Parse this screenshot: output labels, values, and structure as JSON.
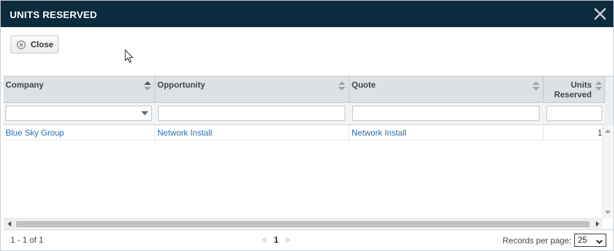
{
  "dialog": {
    "title": "UNITS RESERVED",
    "close_icon": "close-x-icon"
  },
  "toolbar": {
    "close_label": "Close",
    "close_icon": "circle-x-icon"
  },
  "grid": {
    "columns": [
      {
        "label": "Company",
        "sort": "ascending"
      },
      {
        "label": "Opportunity",
        "sort": "none"
      },
      {
        "label": "Quote",
        "sort": "none"
      },
      {
        "label": "Units Reserved",
        "label_line1": "Units",
        "label_line2": "Reserved",
        "sort": "none"
      }
    ],
    "filters": [
      {
        "type": "select",
        "value": ""
      },
      {
        "type": "text",
        "value": ""
      },
      {
        "type": "text",
        "value": ""
      },
      {
        "type": "text",
        "value": ""
      }
    ],
    "rows": [
      {
        "company": "Blue Sky Group",
        "opportunity": "Network Install",
        "quote": "Network Install",
        "units_reserved": "1"
      }
    ]
  },
  "footer": {
    "range_text": "1 - 1 of 1",
    "prev": "<",
    "current_page": "1",
    "next": ">",
    "records_per_page_label": "Records per page:",
    "records_per_page_value": "25"
  },
  "colors": {
    "titlebar": "#0b2b3e",
    "header_bg": "#dde1e4",
    "link": "#2a6ab3"
  }
}
